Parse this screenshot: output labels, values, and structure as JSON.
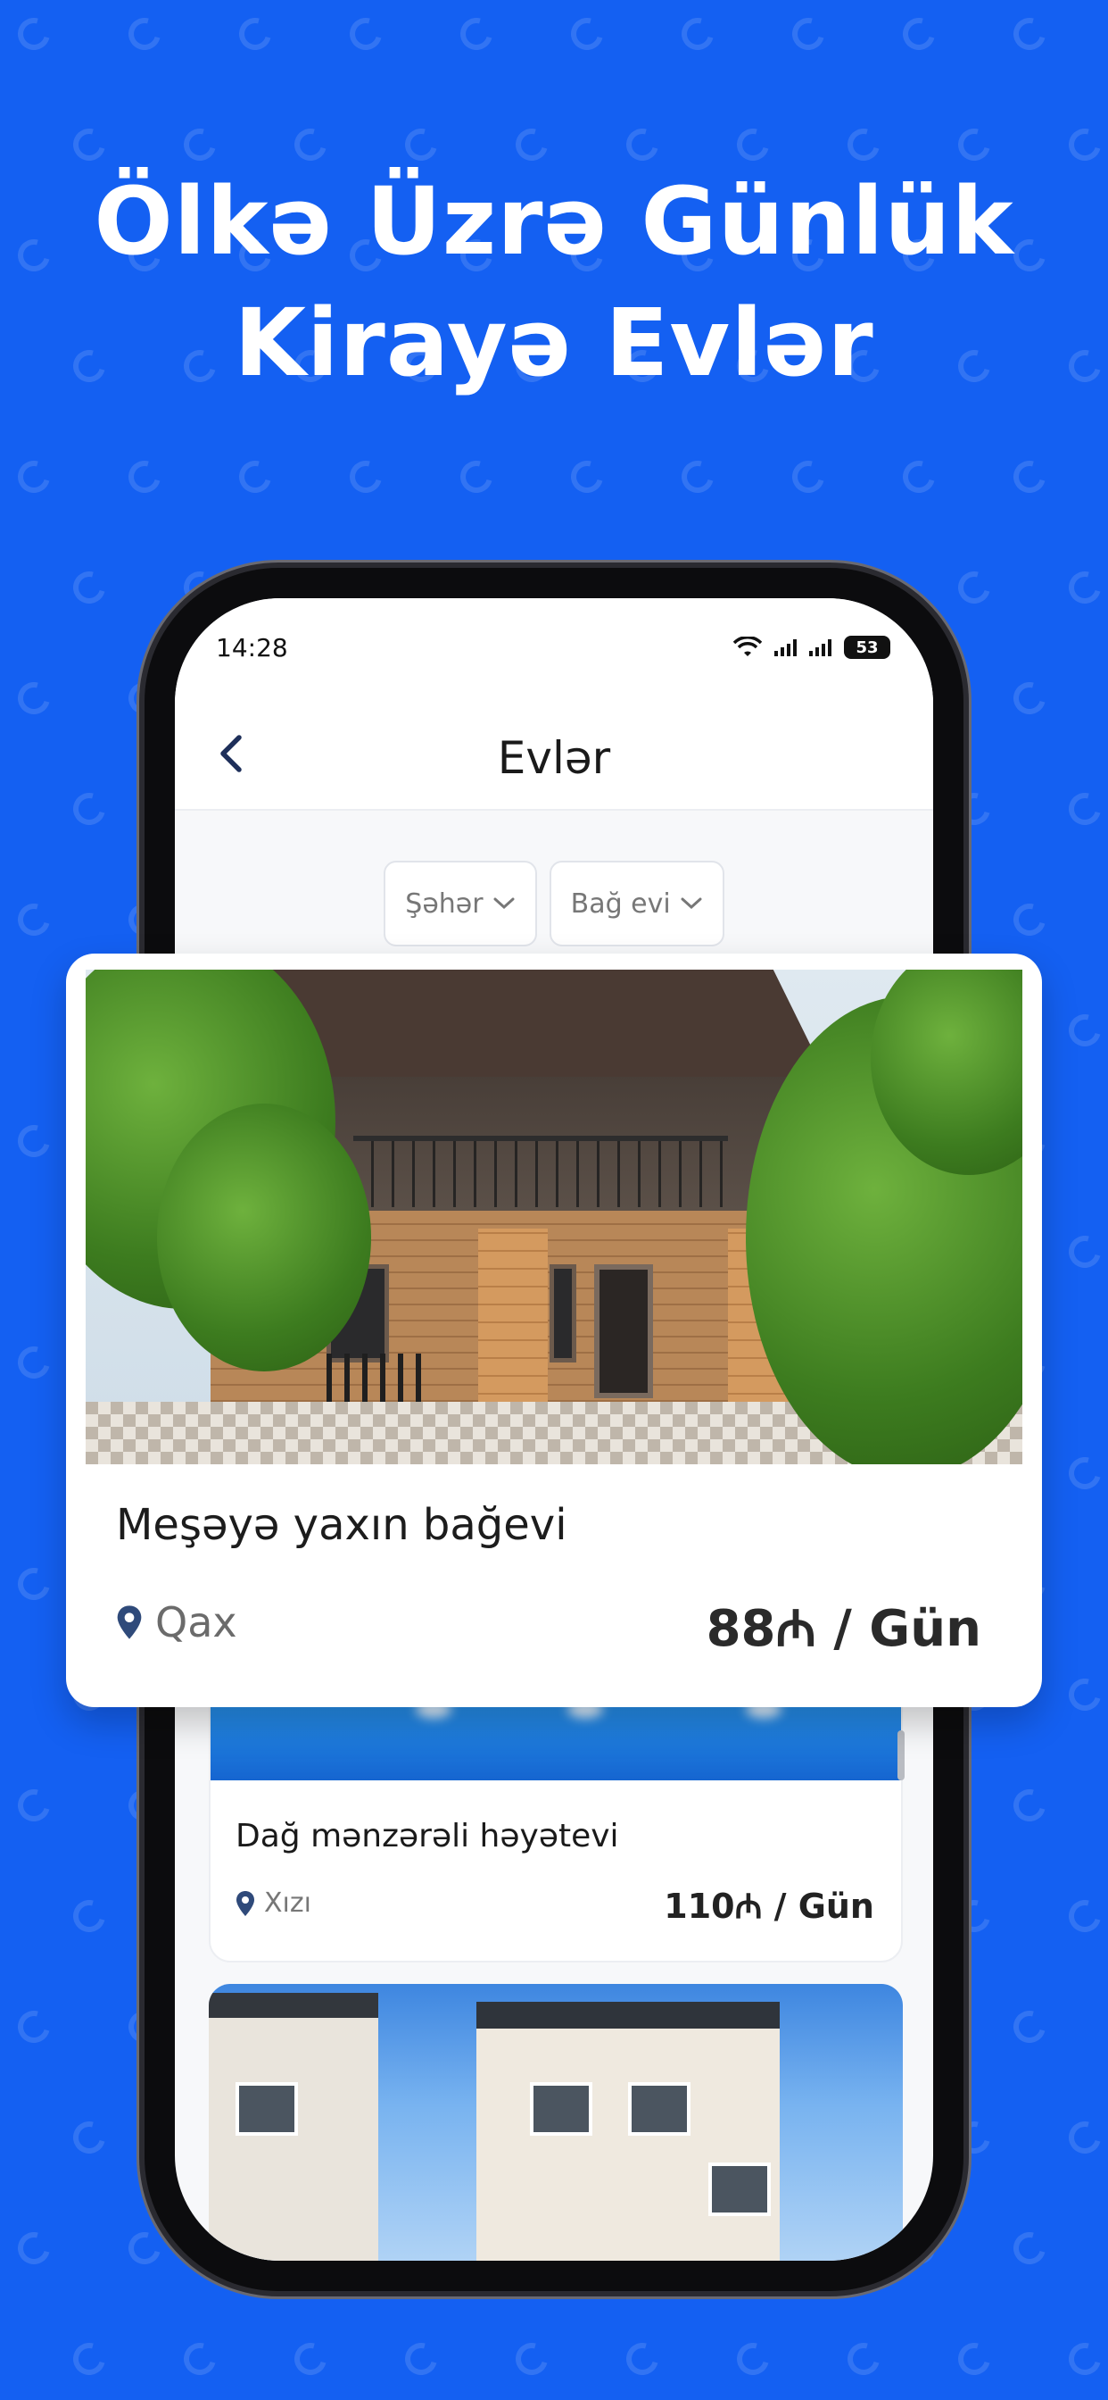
{
  "headline": {
    "line1": "Ölkə Üzrə Günlük",
    "line2": "Kirayə Evlər"
  },
  "colors": {
    "background": "#1460f2",
    "card": "#ffffff",
    "text_dark": "#1c1c1c",
    "text_muted": "#6b6b6b",
    "pin": "#2f4a7a"
  },
  "statusbar": {
    "time": "14:28",
    "battery": "53"
  },
  "navbar": {
    "title": "Evlər",
    "back_icon": "chevron-left-icon"
  },
  "filters": [
    {
      "label": "Şəhər",
      "icon": "chevron-down-icon"
    },
    {
      "label": "Bağ evi",
      "icon": "chevron-down-icon"
    }
  ],
  "featured": {
    "title": "Meşəyə yaxın bağevi",
    "location": "Qax",
    "price": "88₼ / Gün"
  },
  "listings": [
    {
      "title": "Dağ mənzərəli həyətevi",
      "location": "Xızı",
      "price": "110₼ / Gün"
    }
  ]
}
